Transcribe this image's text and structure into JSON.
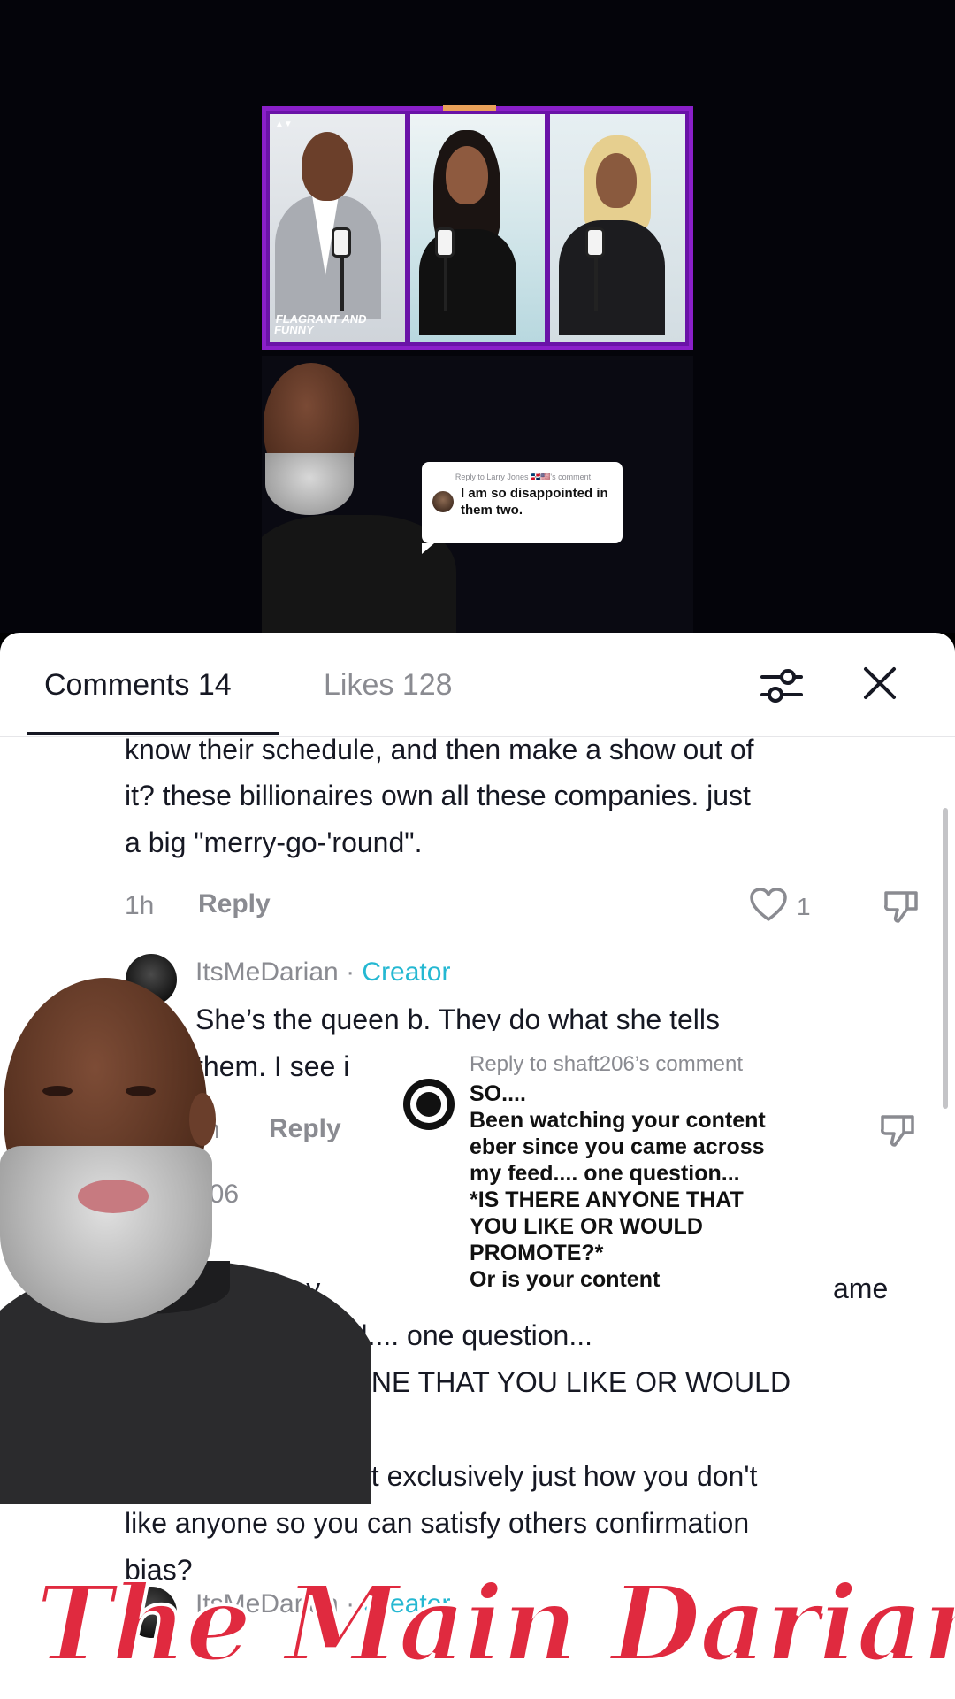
{
  "small_reply": {
    "title": "Reply to Larry Jones 🇩🇴🇺🇸's comment",
    "text": "I am so disappointed in them two."
  },
  "panels": {
    "show_logo": "FLAGRANT AND FUNNY"
  },
  "tabs": {
    "comments": "Comments 14",
    "likes": "Likes 128"
  },
  "comments": [
    {
      "text_lines": [
        "know their schedule, and then make a show out of",
        "it? these billionaires own all these companies. just",
        "a big \"merry-go-'round\"."
      ],
      "time": "1h",
      "reply_label": "Reply",
      "likes": "1"
    },
    {
      "username": "ItsMeDarian",
      "separator": "·",
      "badge": "Creator",
      "text_lines": [
        "She’s the queen b. They do what she tells",
        "them. I see i"
      ],
      "time": "h",
      "reply_label": "Reply"
    },
    {
      "username": "206",
      "text_lines": [
        "tching y",
        "ame",
        "ed.... one question...",
        "ONE THAT YOU LIKE OR WOULD",
        "nt exclusively just how you don't",
        "like anyone so you can satisfy others confirmation",
        "bias?"
      ]
    }
  ],
  "reply_card": {
    "title": "Reply to shaft206’s comment",
    "body": "SO....\nBeen watching your content\neber since you came across\nmy feed.... one question...\n*IS THERE ANYONE THAT\nYOU LIKE OR WOULD\nPROMOTE?*\nOr is your content"
  },
  "brand": "The Main Darian",
  "colors": {
    "creator_badge": "#25b8d2",
    "brand_red": "#e02a3f",
    "panel_border": "#8a1fc9"
  },
  "icons": [
    "filter-icon",
    "close-icon",
    "heart-icon",
    "dislike-icon"
  ]
}
